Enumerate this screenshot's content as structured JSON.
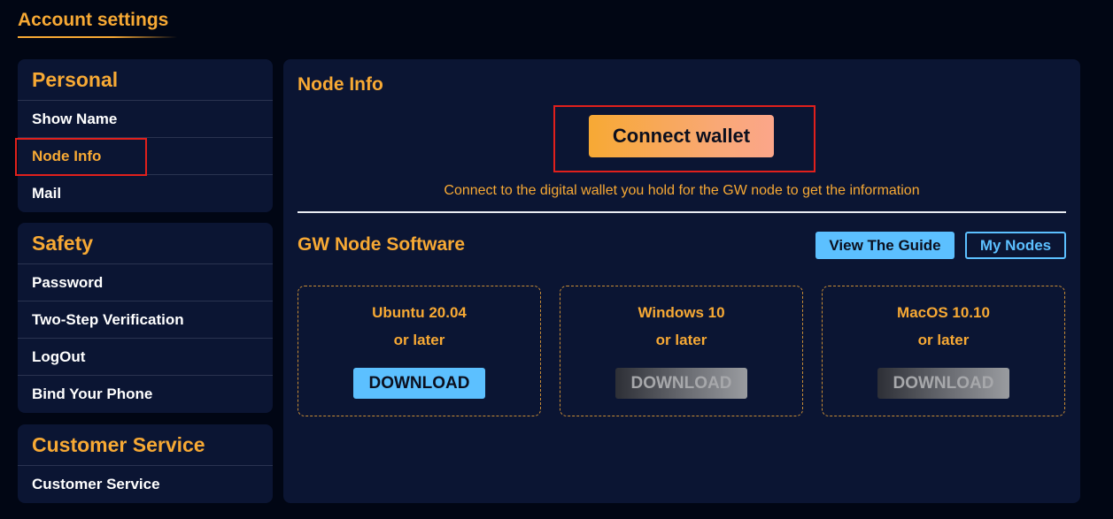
{
  "page": {
    "title": "Account settings"
  },
  "sidebar": {
    "groups": [
      {
        "heading": "Personal",
        "items": [
          "Show Name",
          "Node Info",
          "Mail"
        ],
        "active_index": 1
      },
      {
        "heading": "Safety",
        "items": [
          "Password",
          "Two-Step Verification",
          "LogOut",
          "Bind Your Phone"
        ]
      },
      {
        "heading": "Customer Service",
        "items": [
          "Customer Service"
        ]
      }
    ]
  },
  "main": {
    "node_info": {
      "title": "Node Info",
      "connect_label": "Connect wallet",
      "hint": "Connect to the digital wallet you hold for the GW node to get the information"
    },
    "software": {
      "title": "GW Node Software",
      "guide_label": "View The Guide",
      "my_nodes_label": "My Nodes",
      "downloads": [
        {
          "name": "Ubuntu 20.04",
          "sub": "or later",
          "button": "DOWNLOAD",
          "enabled": true
        },
        {
          "name": "Windows 10",
          "sub": "or later",
          "button": "DOWNLOAD",
          "enabled": false
        },
        {
          "name": "MacOS 10.10",
          "sub": "or later",
          "button": "DOWNLOAD",
          "enabled": false
        }
      ]
    }
  },
  "colors": {
    "background": "#010614",
    "panel": "#0b1533",
    "accent": "#f7a934",
    "link_blue": "#5cc0ff",
    "highlight": "#e0201c"
  }
}
